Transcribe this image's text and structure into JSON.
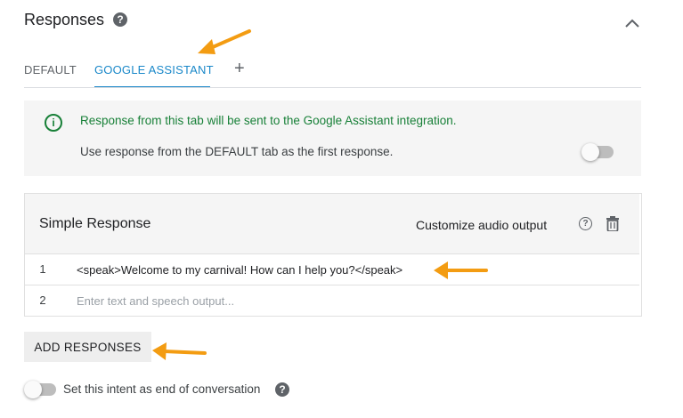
{
  "section": {
    "title": "Responses"
  },
  "tabs": [
    {
      "label": "DEFAULT",
      "active": false
    },
    {
      "label": "GOOGLE ASSISTANT",
      "active": true
    }
  ],
  "tab_add_symbol": "+",
  "info_panel": {
    "message": "Response from this tab will be sent to the Google Assistant integration.",
    "toggle_label": "Use response from the DEFAULT tab as the first response.",
    "toggle_on": false,
    "icon": "info-outline-icon"
  },
  "simple_response": {
    "title": "Simple Response",
    "customize_label": "Customize audio output",
    "rows": [
      {
        "num": "1",
        "text": "<speak>Welcome to my carnival!  How can I help you?</speak>"
      },
      {
        "num": "2",
        "text": "",
        "placeholder": "Enter text and speech output..."
      }
    ]
  },
  "add_button_label": "ADD RESPONSES",
  "end_conversation": {
    "label": "Set this intent as end of conversation",
    "toggle_on": false
  },
  "colors": {
    "accent": "#1a88c9",
    "success": "#188038",
    "annotation": "#f39c12"
  }
}
